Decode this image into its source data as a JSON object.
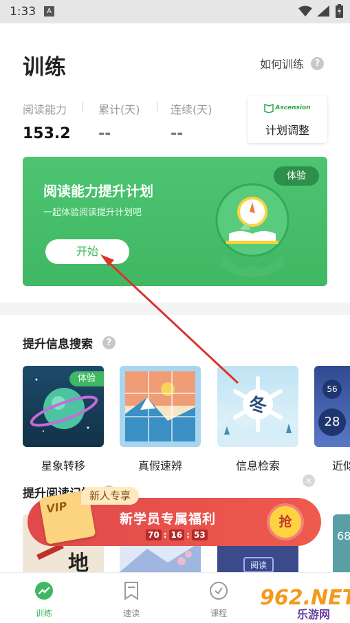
{
  "status_bar": {
    "time": "1:33",
    "notification_icon": "a-icon",
    "wifi_icon": "wifi-icon",
    "signal_icon": "signal-icon",
    "battery_icon": "battery-icon"
  },
  "header": {
    "title": "训练",
    "how_to_label": "如何训练",
    "help_icon": "?"
  },
  "stats": [
    {
      "label": "阅读能力",
      "value": "153.2"
    },
    {
      "label": "累计(天)",
      "value": "--"
    },
    {
      "label": "连续(天)",
      "value": "--"
    }
  ],
  "plan_button": {
    "logo_text": "Ascension",
    "label": "计划调整"
  },
  "plan_card": {
    "title": "阅读能力提升计划",
    "subtitle": "一起体验阅读提升计划吧",
    "start_label": "开始",
    "badge": "体验",
    "accent": "#3fb763"
  },
  "section1": {
    "title": "提升信息搜索",
    "help_icon": "?",
    "tiles": [
      {
        "label": "星象转移",
        "tag": "体验"
      },
      {
        "label": "真假速辨"
      },
      {
        "label": "信息检索",
        "glyph": "冬"
      },
      {
        "label": "近似",
        "numbers": [
          "56",
          "28"
        ]
      }
    ]
  },
  "section2": {
    "title": "提升阅读记忆",
    "help_icon": "?",
    "tile_texts": [
      "地",
      "阅读",
      "68"
    ]
  },
  "promo": {
    "new_tag": "新人专享",
    "vip": "VIP",
    "main_text": "新学员专属福利",
    "timer": [
      "70",
      "16",
      "53"
    ],
    "grab": "抢",
    "close": "×",
    "color": "#e04a4a"
  },
  "tabbar": {
    "tabs": [
      {
        "label": "训练",
        "icon": "trend-icon",
        "active": true
      },
      {
        "label": "速读",
        "icon": "bookmark-icon",
        "active": false
      },
      {
        "label": "课程",
        "icon": "check-circle-icon",
        "active": false
      }
    ]
  },
  "watermark": {
    "number": "962.NET",
    "site": "乐游网"
  }
}
